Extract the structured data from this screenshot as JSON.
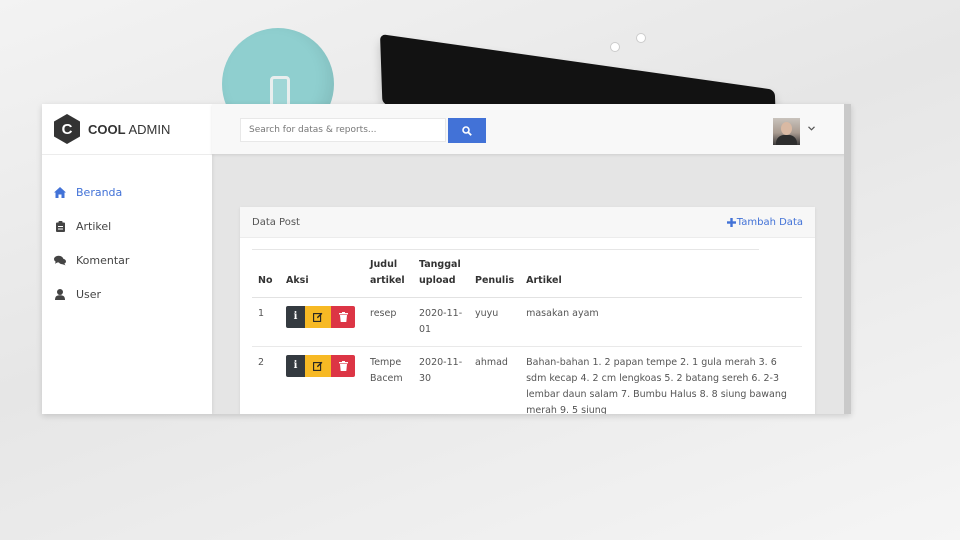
{
  "brand": {
    "bold": "COOL",
    "rest": "ADMIN",
    "letter": "C"
  },
  "sidebar": {
    "items": [
      {
        "label": "Beranda",
        "icon": "home-icon",
        "active": true
      },
      {
        "label": "Artikel",
        "icon": "clipboard-icon",
        "active": false
      },
      {
        "label": "Komentar",
        "icon": "comments-icon",
        "active": false
      },
      {
        "label": "User",
        "icon": "user-icon",
        "active": false
      }
    ]
  },
  "header": {
    "search": {
      "placeholder": "Search for datas & reports..."
    },
    "search_icon": "search-icon",
    "user_menu_icon": "chevron-down-icon"
  },
  "card": {
    "title": "Data Post",
    "add_label": "Tambah Data"
  },
  "table": {
    "columns": [
      "No",
      "Aksi",
      "Judul artikel",
      "Tanggal upload",
      "Penulis",
      "Artikel"
    ],
    "rows": [
      {
        "no": "1",
        "judul": "resep",
        "tanggal": "2020-11-01",
        "penulis": "yuyu",
        "artikel": "masakan ayam"
      },
      {
        "no": "2",
        "judul": "Tempe Bacem",
        "tanggal": "2020-11-30",
        "penulis": "ahmad",
        "artikel": "Bahan-bahan 1. 2 papan tempe 2. 1 gula merah 3. 6 sdm kecap 4. 2 cm lengkoas 5. 2 batang sereh 6. 2-3 lembar daun salam 7. Bumbu Halus 8. 8 siung bawang merah 9. 5 siung"
      }
    ]
  },
  "colors": {
    "accent": "#4272d7",
    "info": "#343a40",
    "warning": "#f7b924",
    "danger": "#dc3545"
  }
}
